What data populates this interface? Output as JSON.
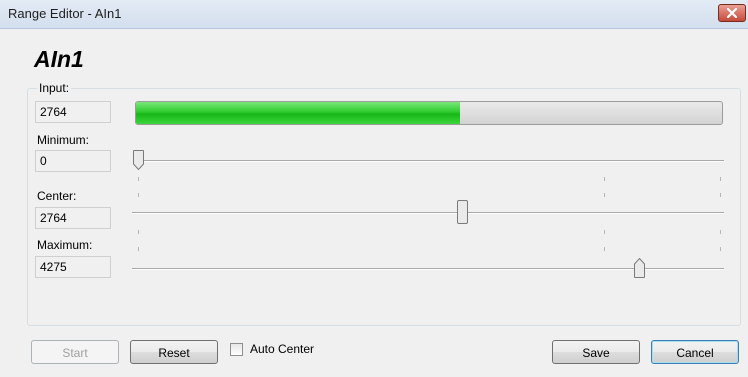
{
  "window": {
    "title": "Range Editor - AIn1",
    "close_icon": "close-icon"
  },
  "heading": "AIn1",
  "group_label": "Input: ",
  "input": {
    "value": "2764",
    "progress_fraction": 0.553
  },
  "minimum": {
    "label": "Minimum:",
    "value": "0",
    "slider_fraction": 0.0
  },
  "center": {
    "label": "Center:",
    "value": "2764",
    "slider_fraction": 0.553
  },
  "maximum": {
    "label": "Maximum:",
    "value": "4275",
    "slider_fraction": 0.855
  },
  "buttons": {
    "start": "Start",
    "reset": "Reset",
    "save": "Save",
    "cancel": "Cancel"
  },
  "auto_center": {
    "label": "Auto Center",
    "checked": false
  },
  "colors": {
    "progress": "#22c322",
    "title_bar": "#dbe6f3",
    "background": "#f0f0f0",
    "close": "#c64b3b"
  }
}
